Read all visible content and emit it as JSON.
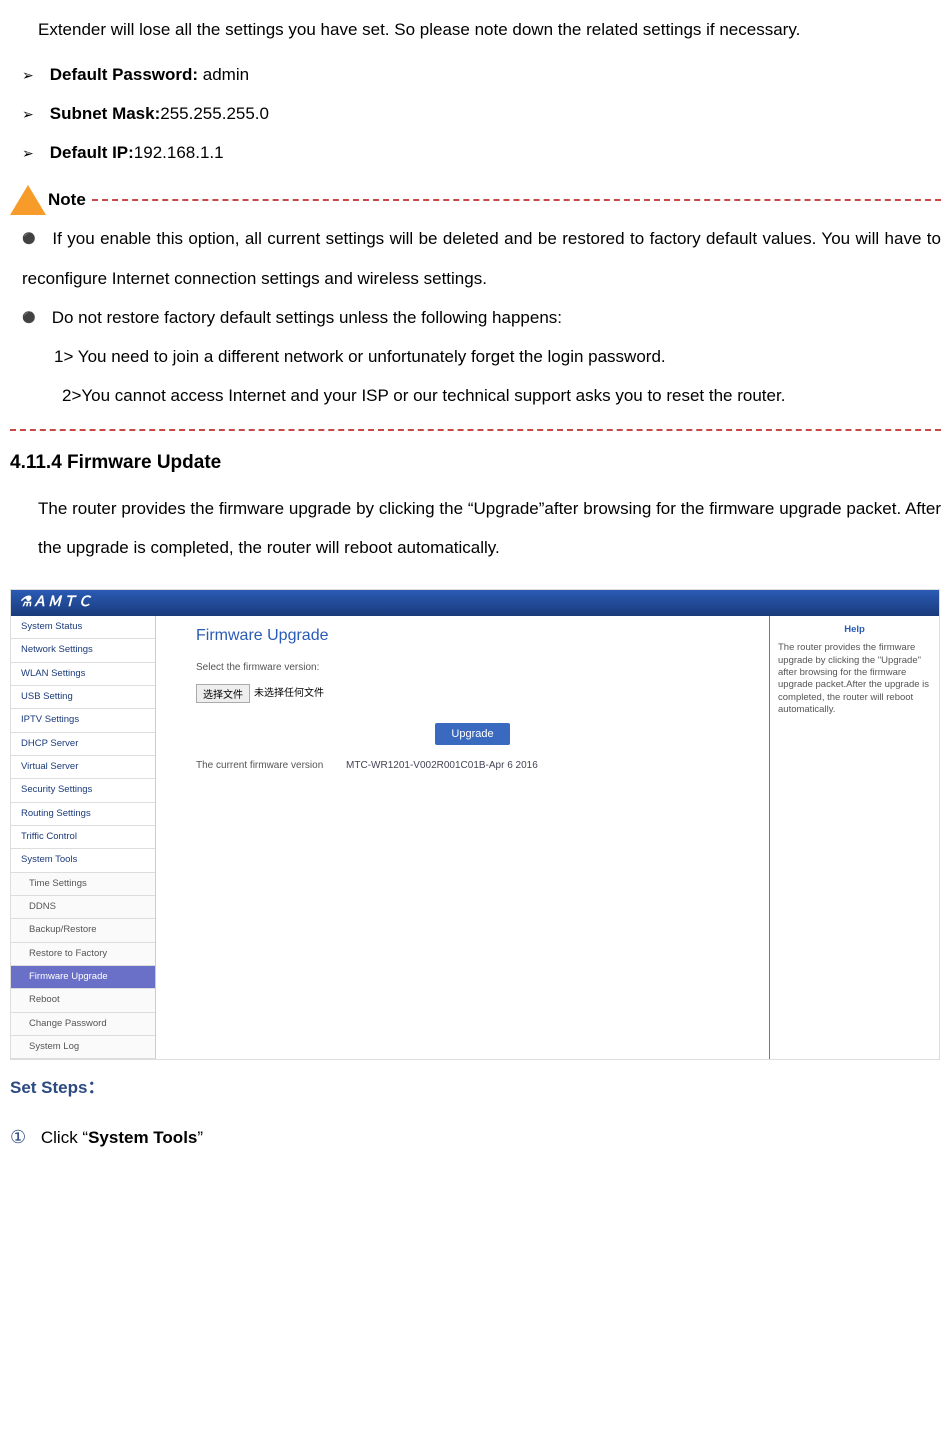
{
  "top_paragraph": "Extender will lose all the settings you have set. So please note down the related settings if necessary.",
  "defaults": [
    {
      "label": "Default Password:",
      "value": " admin"
    },
    {
      "label": "Subnet Mask:",
      "value": "255.255.255.0"
    },
    {
      "label": "Default IP:",
      "value": "192.168.1.1"
    }
  ],
  "note_label": "Note",
  "bullets": [
    "If you enable this option, all current settings will be deleted and be restored to factory default values. You will have to reconfigure Internet connection settings and wireless settings.",
    "Do not restore factory default settings unless the following happens:"
  ],
  "sub1": "1>  You need to join a different network or unfortunately forget the login password.",
  "sub2": "2>You cannot access Internet and your ISP or our technical support asks you to reset the router.",
  "section_heading": "4.11.4 Firmware Update",
  "section_body": "The router provides the firmware upgrade by clicking the “Upgrade”after browsing for the firmware upgrade packet.    After the upgrade is completed, the router will reboot automatically.",
  "set_steps_label": "Set Steps：",
  "step1_num": "①",
  "step1_prefix": "Click “",
  "step1_bold": "System Tools",
  "step1_suffix": "”",
  "router": {
    "brand": "⚗ＡＭＴＣ",
    "nav": [
      {
        "label": "System Status",
        "sub": false
      },
      {
        "label": "Network Settings",
        "sub": false
      },
      {
        "label": "WLAN Settings",
        "sub": false
      },
      {
        "label": "USB Setting",
        "sub": false
      },
      {
        "label": "IPTV Settings",
        "sub": false
      },
      {
        "label": "DHCP Server",
        "sub": false
      },
      {
        "label": "Virtual Server",
        "sub": false
      },
      {
        "label": "Security Settings",
        "sub": false
      },
      {
        "label": "Routing Settings",
        "sub": false
      },
      {
        "label": "Triffic Control",
        "sub": false
      },
      {
        "label": "System Tools",
        "sub": false
      },
      {
        "label": "Time Settings",
        "sub": true
      },
      {
        "label": "DDNS",
        "sub": true
      },
      {
        "label": "Backup/Restore",
        "sub": true
      },
      {
        "label": "Restore to Factory",
        "sub": true
      },
      {
        "label": "Firmware Upgrade",
        "sub": true,
        "active": true
      },
      {
        "label": "Reboot",
        "sub": true
      },
      {
        "label": "Change Password",
        "sub": true
      },
      {
        "label": "System Log",
        "sub": true
      }
    ],
    "content": {
      "title": "Firmware Upgrade",
      "select_label": "Select the firmware version:",
      "choose_btn": "选择文件",
      "no_file": "未选择任何文件",
      "upgrade_btn": "Upgrade",
      "current_label": "The current firmware version",
      "current_value": "MTC-WR1201-V002R001C01B-Apr 6 2016"
    },
    "help": {
      "title": "Help",
      "body": "The router provides the firmware upgrade by clicking the \"Upgrade\" after browsing for the firmware upgrade packet.After the upgrade is completed, the router will reboot automatically."
    }
  }
}
